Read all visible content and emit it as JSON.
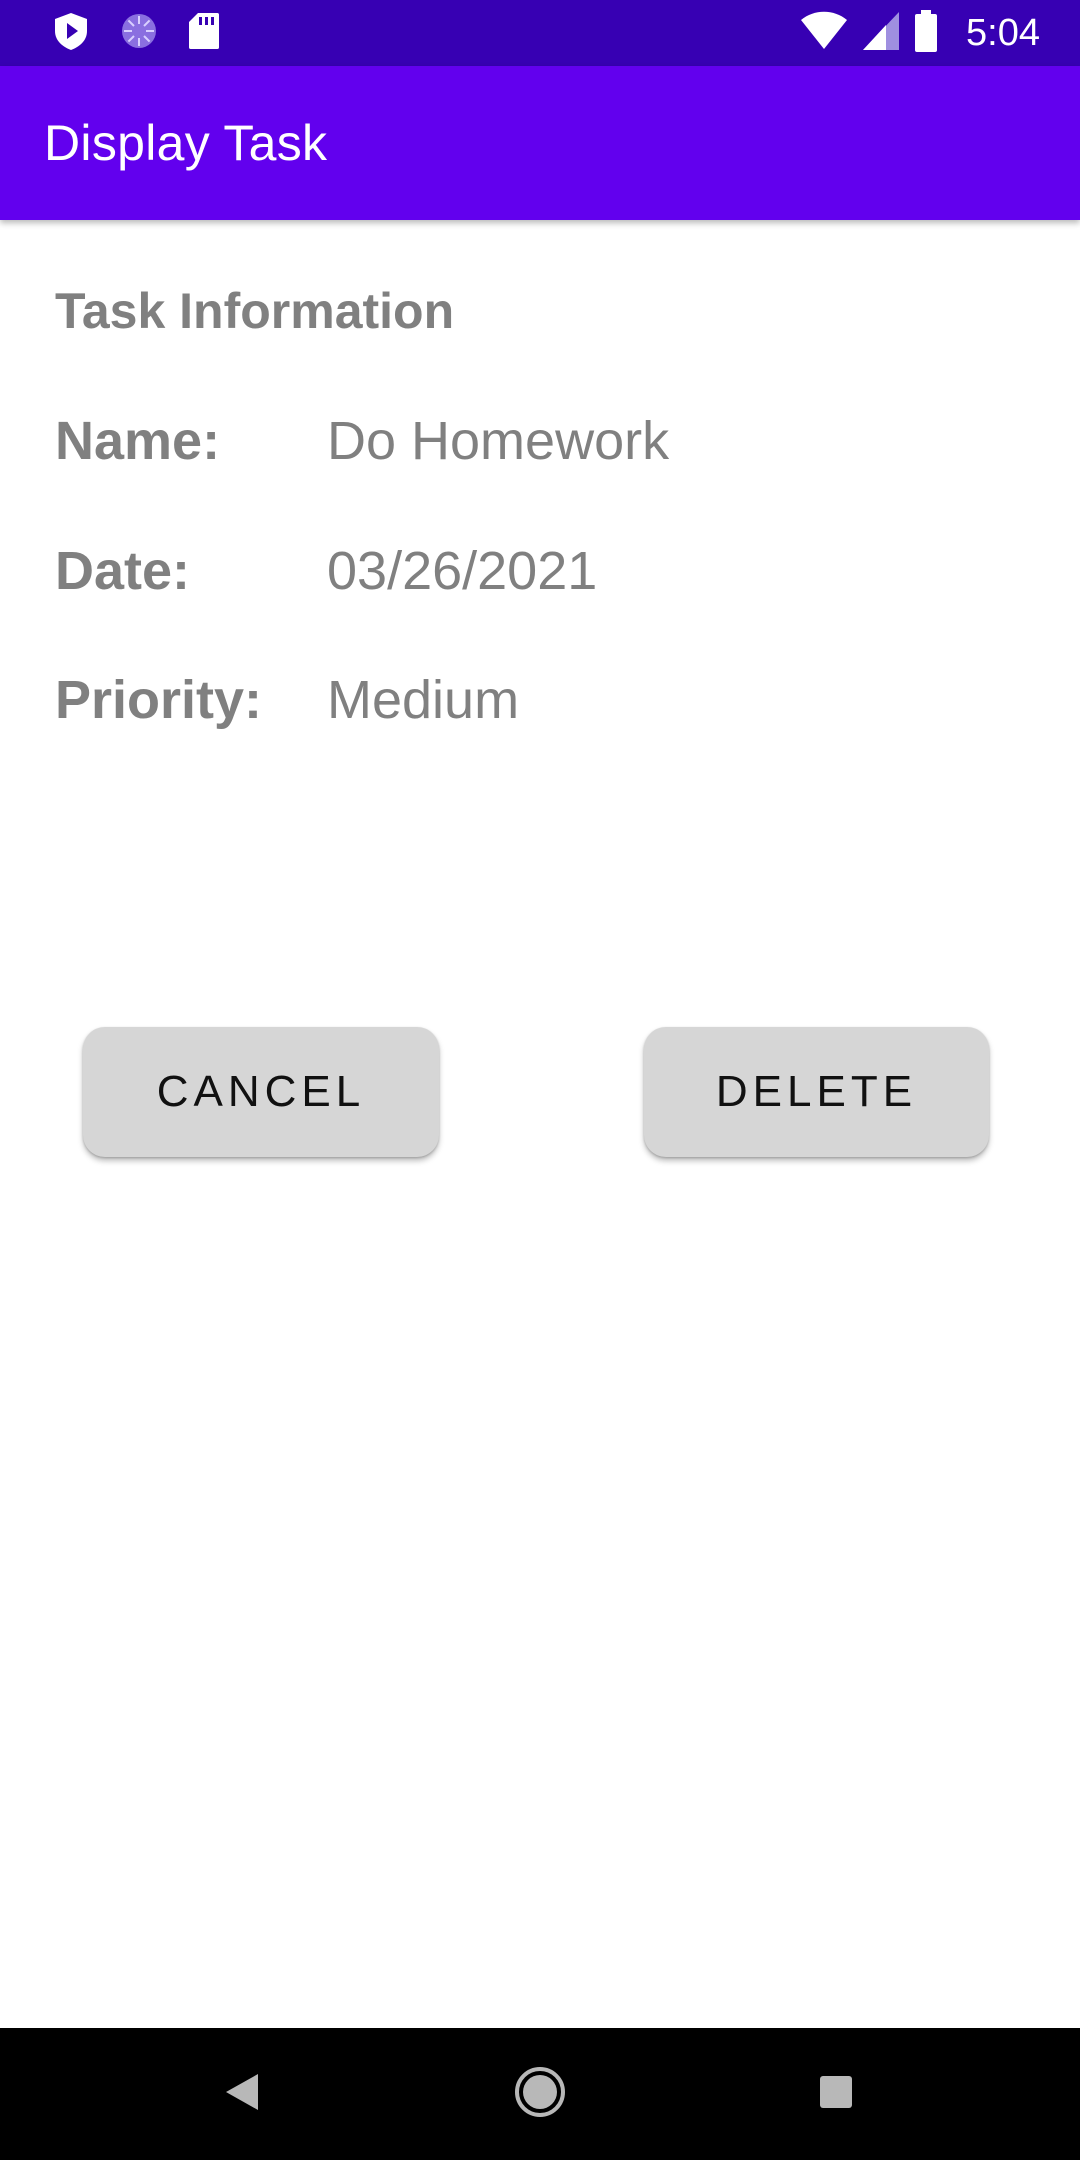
{
  "status_bar": {
    "time": "5:04",
    "left_icons": [
      "shield-icon",
      "spinner-icon",
      "sd-card-icon"
    ],
    "right_icons": [
      "wifi-icon",
      "signal-icon",
      "battery-icon"
    ],
    "background": "#3700b3"
  },
  "app_bar": {
    "title": "Display Task",
    "background": "#6200ee"
  },
  "task_info": {
    "heading": "Task Information",
    "name_label": "Name:",
    "name_value": "Do Homework",
    "date_label": "Date:",
    "date_value": "03/26/2021",
    "priority_label": "Priority:",
    "priority_value": "Medium"
  },
  "actions": {
    "cancel_label": "CANCEL",
    "delete_label": "DELETE"
  },
  "nav_bar": {
    "icons": [
      "back-icon",
      "home-icon",
      "recents-icon"
    ]
  }
}
